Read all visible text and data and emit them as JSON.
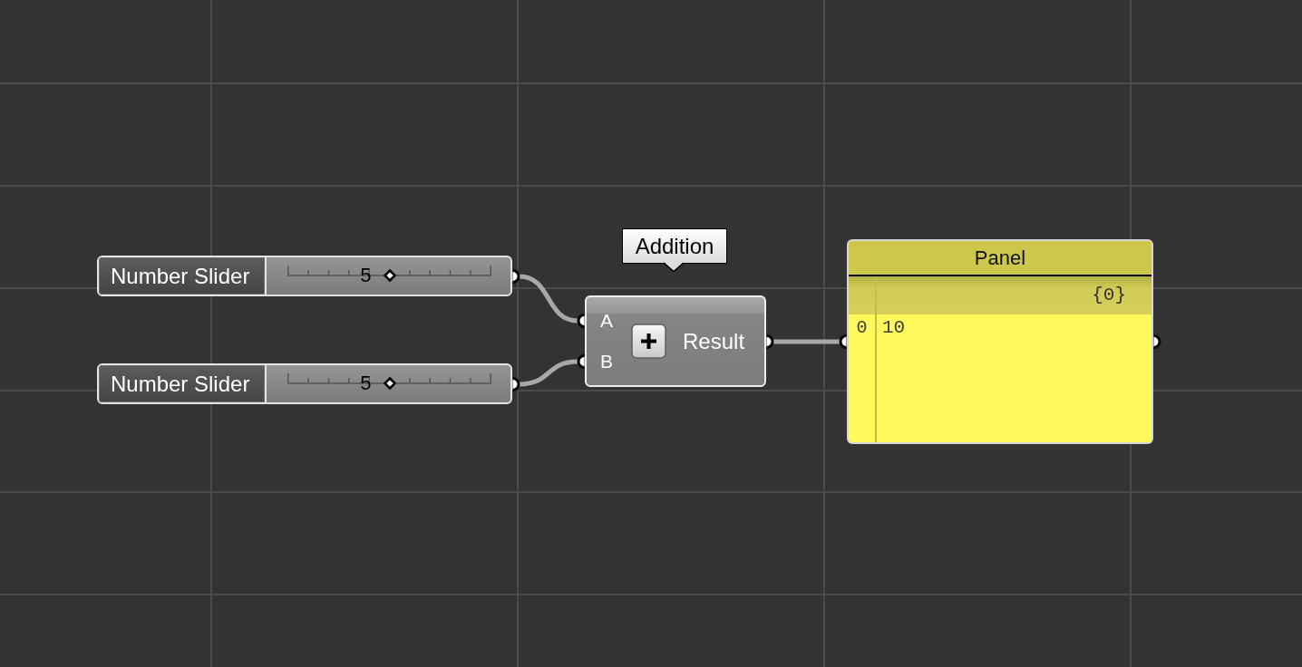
{
  "sliders": [
    {
      "label": "Number Slider",
      "value": "5",
      "level": 0.5
    },
    {
      "label": "Number Slider",
      "value": "5",
      "level": 0.5
    }
  ],
  "addition": {
    "tooltip": "Addition",
    "inputs": [
      "A",
      "B"
    ],
    "output": "Result"
  },
  "panel": {
    "title": "Panel",
    "path": "{0}",
    "rows": [
      {
        "index": "0",
        "value": "10"
      }
    ]
  }
}
